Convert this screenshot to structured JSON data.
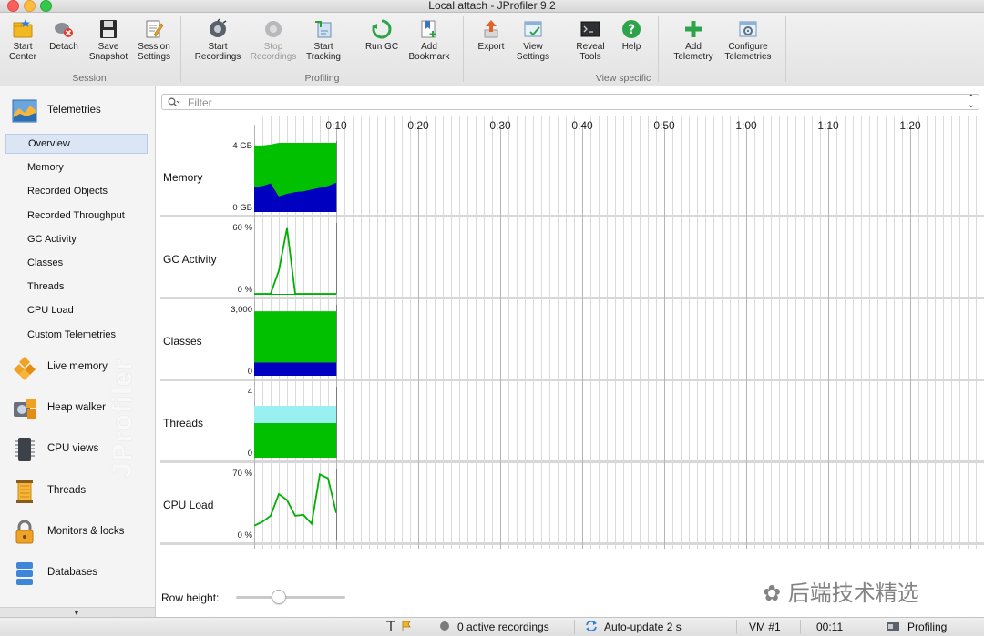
{
  "window": {
    "title": "Local attach - JProfiler 9.2"
  },
  "toolbar": {
    "groups": [
      {
        "label": "Session",
        "buttons": [
          {
            "label": "Start\nCenter",
            "icon": "folder-star-icon"
          },
          {
            "label": "Detach",
            "icon": "detach-icon"
          },
          {
            "label": "Save\nSnapshot",
            "icon": "floppy-disk-icon"
          },
          {
            "label": "Session\nSettings",
            "icon": "session-settings-icon"
          }
        ]
      },
      {
        "label": "Profiling",
        "buttons": [
          {
            "label": "Start\nRecordings",
            "icon": "recordings-icon"
          },
          {
            "label": "Stop\nRecordings",
            "icon": "stop-recordings-icon",
            "disabled": true
          },
          {
            "label": "Start\nTracking",
            "icon": "tracking-icon"
          },
          {
            "label": "Run GC",
            "icon": "recycle-icon"
          },
          {
            "label": "Add\nBookmark",
            "icon": "bookmark-icon"
          }
        ]
      },
      {
        "label": "View specific",
        "buttons": [
          {
            "label": "Export",
            "icon": "export-icon"
          },
          {
            "label": "View\nSettings",
            "icon": "view-settings-icon"
          },
          {
            "label": "Reveal\nTools",
            "icon": "terminal-icon"
          },
          {
            "label": "Help",
            "icon": "help-icon"
          }
        ]
      },
      {
        "label": "",
        "buttons": [
          {
            "label": "Add\nTelemetry",
            "icon": "plus-icon"
          },
          {
            "label": "Configure\nTelemetries",
            "icon": "configure-icon"
          }
        ]
      }
    ]
  },
  "sidebar": {
    "telemetries": {
      "label": "Telemetries"
    },
    "items": [
      "Overview",
      "Memory",
      "Recorded Objects",
      "Recorded Throughput",
      "GC Activity",
      "Classes",
      "Threads",
      "CPU Load",
      "Custom Telemetries"
    ],
    "selected": "Overview",
    "sections": [
      "Live memory",
      "Heap walker",
      "CPU views",
      "Threads",
      "Monitors & locks",
      "Databases"
    ],
    "watermark": "JProfiler"
  },
  "main": {
    "filter_placeholder": "Filter",
    "time_ticks": [
      "0:10",
      "0:20",
      "0:30",
      "0:40",
      "0:50",
      "1:00",
      "1:10",
      "1:20"
    ],
    "rows": [
      {
        "label": "Memory",
        "axis_top": "4 GB",
        "axis_bottom": "0 GB"
      },
      {
        "label": "GC Activity",
        "axis_top": "60 %",
        "axis_bottom": "0 %"
      },
      {
        "label": "Classes",
        "axis_top": "3,000",
        "axis_bottom": "0"
      },
      {
        "label": "Threads",
        "axis_top": "4",
        "axis_bottom": "0"
      },
      {
        "label": "CPU Load",
        "axis_top": "70 %",
        "axis_bottom": "0 %"
      }
    ],
    "row_height_label": "Row height:",
    "row_height_value": 0.38,
    "wechat_watermark": "后端技术精选"
  },
  "chart_data": [
    {
      "type": "area",
      "title": "Memory",
      "xlabel": "",
      "ylabel": "",
      "ylim": [
        0,
        4
      ],
      "x": [
        0,
        1,
        2,
        3,
        4,
        5,
        6,
        7,
        8,
        9,
        10
      ],
      "series": [
        {
          "name": "",
          "values": [
            3.85,
            3.85,
            3.9,
            4.0,
            4.0,
            4.0,
            4.0,
            4.0,
            4.0,
            4.0,
            4.0
          ],
          "color": "#00c000"
        },
        {
          "name": "",
          "values": [
            1.45,
            1.5,
            1.65,
            0.9,
            1.05,
            1.15,
            1.2,
            1.3,
            1.4,
            1.5,
            1.7
          ],
          "color": "#0000c0"
        }
      ]
    },
    {
      "type": "line",
      "title": "GC Activity",
      "xlabel": "",
      "ylabel": "",
      "ylim": [
        0,
        60
      ],
      "x": [
        0,
        1,
        2,
        3,
        4,
        5,
        6,
        7,
        8,
        9,
        10
      ],
      "series": [
        {
          "name": "",
          "values": [
            0,
            0,
            0,
            20,
            57,
            0,
            0,
            0,
            0,
            0,
            0
          ],
          "color": "#00b000"
        }
      ]
    },
    {
      "type": "area",
      "title": "Classes",
      "xlabel": "",
      "ylabel": "",
      "ylim": [
        0,
        3000
      ],
      "x": [
        0,
        10
      ],
      "series": [
        {
          "name": "",
          "values": [
            2800,
            2800
          ],
          "color": "#00c000"
        },
        {
          "name": "",
          "values": [
            570,
            570
          ],
          "color": "#0000c0"
        }
      ]
    },
    {
      "type": "area",
      "title": "Threads",
      "xlabel": "",
      "ylabel": "",
      "ylim": [
        0,
        4
      ],
      "x": [
        0,
        10
      ],
      "series": [
        {
          "name": "",
          "values": [
            3.0,
            3.0
          ],
          "color": "#99f0f0"
        },
        {
          "name": "",
          "values": [
            2.0,
            2.0
          ],
          "color": "#00c000"
        }
      ]
    },
    {
      "type": "line",
      "title": "CPU Load",
      "xlabel": "",
      "ylabel": "",
      "ylim": [
        0,
        70
      ],
      "x": [
        0,
        1,
        2,
        3,
        4,
        5,
        6,
        7,
        8,
        9,
        10
      ],
      "series": [
        {
          "name": "",
          "values": [
            14,
            18,
            24,
            46,
            40,
            24,
            25,
            16,
            66,
            62,
            27
          ],
          "color": "#00b000"
        }
      ]
    }
  ],
  "statusbar": {
    "active_recordings": "0 active recordings",
    "auto_update": "Auto-update 2 s",
    "vm": "VM #1",
    "elapsed": "00:11",
    "mode": "Profiling"
  }
}
